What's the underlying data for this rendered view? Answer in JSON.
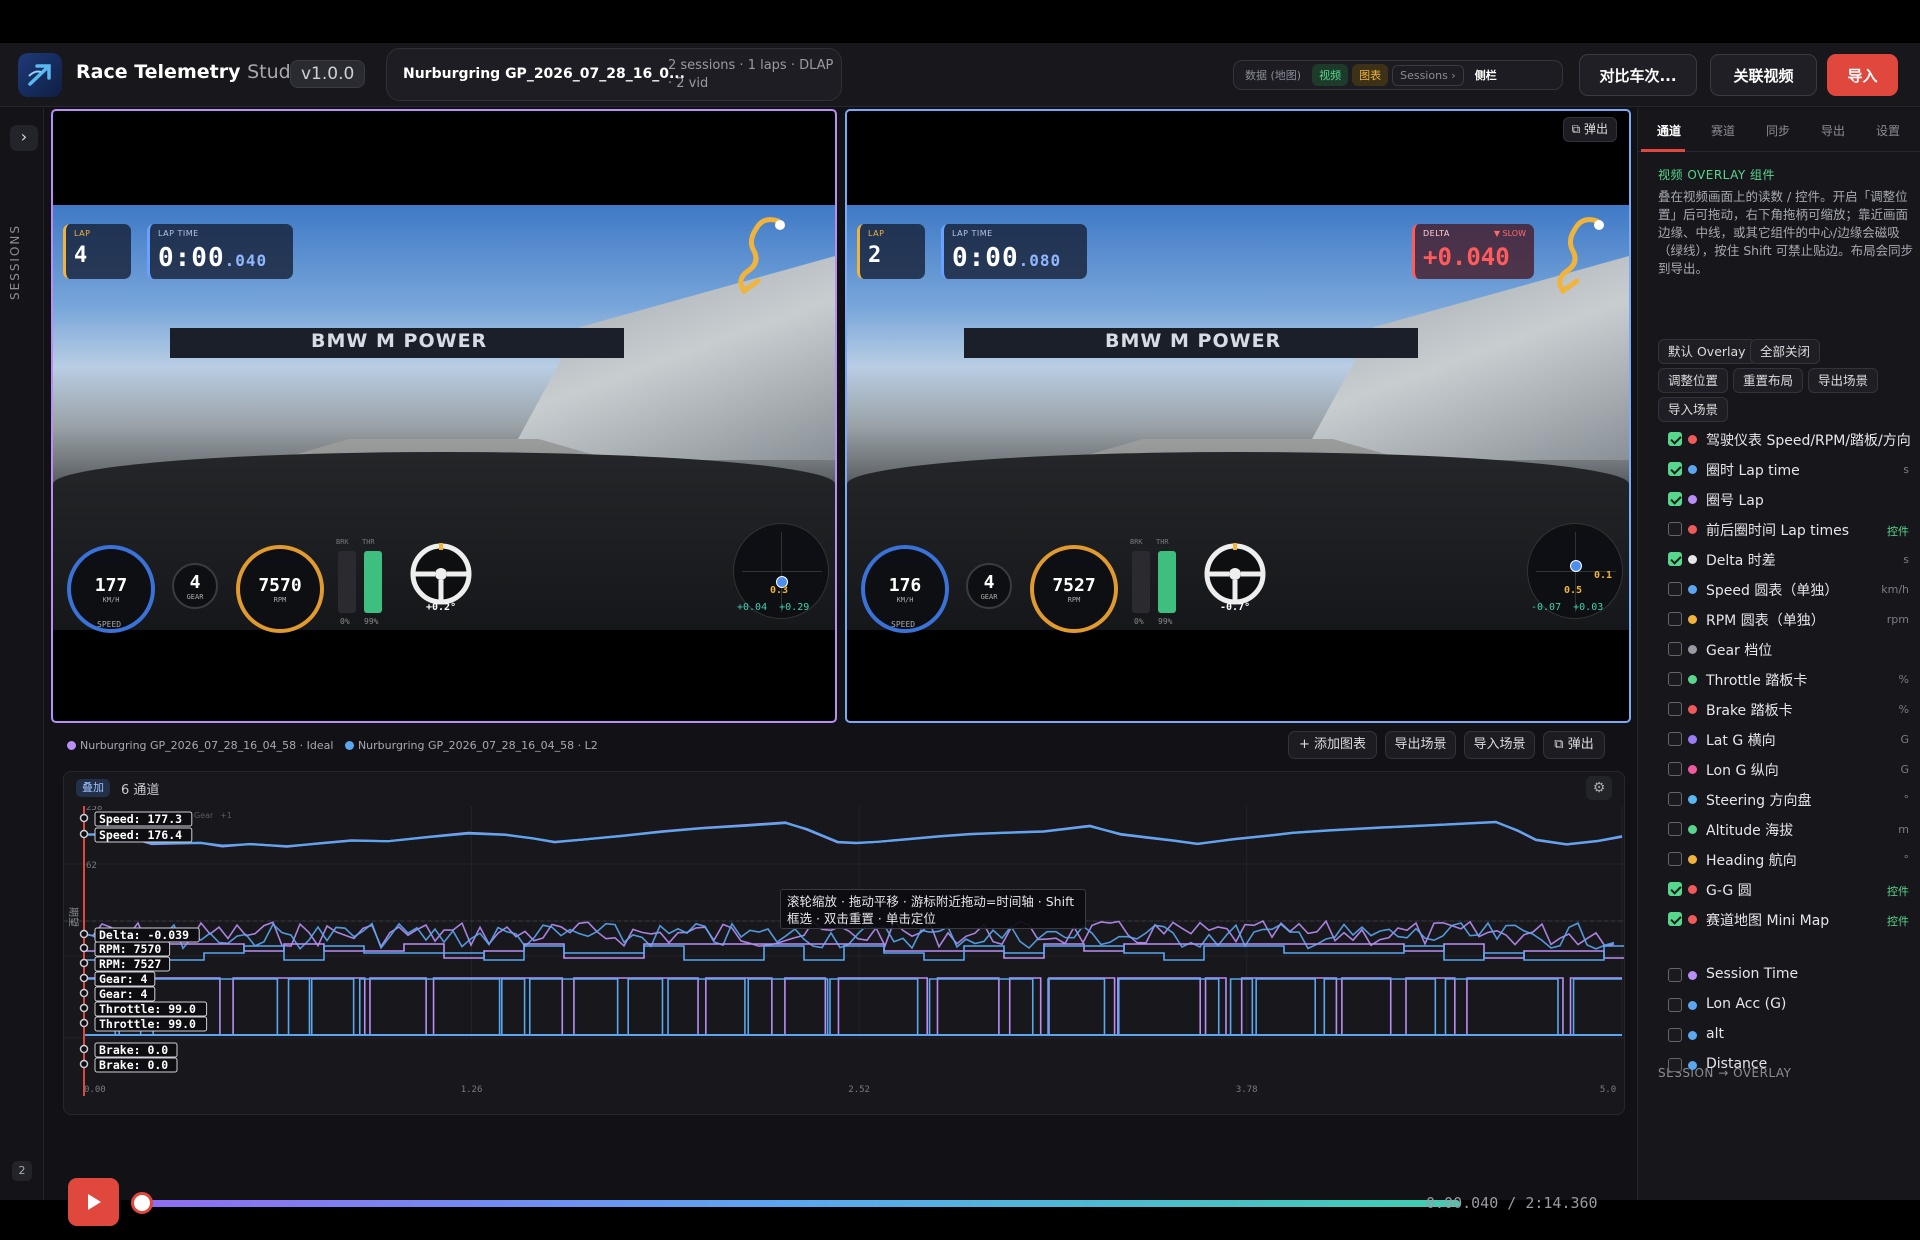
{
  "app": {
    "name": "Race Telemetry",
    "suffix": "Studio",
    "version": "v1.0.0"
  },
  "session": {
    "name": "Nurburgring GP_2026_07_28_16_0...",
    "meta": "2 sessions · 1 laps · DLAP · 2 vid"
  },
  "view_toggle": [
    {
      "label": "数据 (地图)",
      "style": "plain"
    },
    {
      "label": "视频",
      "style": "green"
    },
    {
      "label": "图表",
      "style": "amber"
    },
    {
      "label": "Sessions ›",
      "style": "outline"
    },
    {
      "label": "侧栏",
      "style": "bold"
    }
  ],
  "header_buttons": {
    "compare": "对比车次...",
    "link_video": "关联视频",
    "import": "导入"
  },
  "rail": {
    "label": "SESSIONS",
    "toggle": "›",
    "count": "2"
  },
  "video_a": {
    "lap_label": "LAP",
    "lap": "4",
    "laptime_label": "LAP TIME",
    "laptime_main": "0:00",
    "laptime_ms": ".040",
    "speed": "177",
    "speed_unit": "KM/H",
    "speed_label": "SPEED",
    "gear": "4",
    "gear_label": "GEAR",
    "rpm": "7570",
    "rpm_label": "RPM",
    "brk": "BRK",
    "thr": "THR",
    "brk_val": "0%",
    "thr_val": "99%",
    "steer": "+0.2°",
    "gg_center": "0.3",
    "gg_bottom": "+0.04  +0.29",
    "gantry": "BMW  M POWER",
    "border_color": "#b98ef5"
  },
  "video_b": {
    "lap_label": "LAP",
    "lap": "2",
    "laptime_label": "LAP TIME",
    "laptime_main": "0:00",
    "laptime_ms": ".080",
    "delta_label": "DELTA",
    "delta_state": "▼ SLOW",
    "delta": "+0.040",
    "speed": "176",
    "speed_unit": "KM/H",
    "speed_label": "SPEED",
    "gear": "4",
    "gear_label": "GEAR",
    "rpm": "7527",
    "rpm_label": "RPM",
    "brk": "BRK",
    "thr": "THR",
    "brk_val": "0%",
    "thr_val": "99%",
    "steer": "-0.7°",
    "gg_right": "0.1",
    "gg_center": "0.5",
    "gg_bottom": "-0.07  +0.03",
    "popout": "弹出",
    "gantry": "BMW  M POWER",
    "border_color": "#7aa9f5"
  },
  "charts_section": {
    "legend": [
      {
        "label": "Nurburgring GP_2026_07_28_16_04_58 · Ideal",
        "color": "#b98ef5"
      },
      {
        "label": "Nurburgring GP_2026_07_28_16_04_58 · L2",
        "color": "#5aa7f0"
      }
    ],
    "buttons": {
      "add_chart": "+ 添加图表",
      "export_scene": "导出场景",
      "import_scene": "导入场景",
      "popout": "弹出"
    },
    "overlay_badge": "叠加",
    "channel_count": "6 通道",
    "tooltip": "滚轮缩放 · 拖动平移 · 游标附近拖动=时间轴 · Shift 框选 · 双击重置 · 单击定位",
    "cursor_tags": [
      "Speed: 177.3",
      "Speed: 176.4",
      "Delta: -0.039",
      "RPM: 7570",
      "RPM: 7527",
      "Gear: 4",
      "Gear: 4",
      "Throttle: 99.0",
      "Throttle: 99.0",
      "Brake: 0.0",
      "Brake: 0.0"
    ],
    "speed_axis": [
      "258",
      "62"
    ],
    "faint_labels": [
      "RPM",
      "Gear",
      "+1"
    ],
    "side_label": "期望",
    "x_ticks": [
      "0.00",
      "1.26",
      "2.52",
      "3.78",
      "5.0"
    ]
  },
  "chart_data": {
    "type": "line",
    "x_label": "",
    "xlim": [
      0,
      5.0
    ],
    "x_ticks": [
      0.0,
      1.26,
      2.52,
      3.78,
      5.0
    ],
    "speed_range": [
      62,
      258
    ],
    "cursor_x": 0.0,
    "series": [
      {
        "name": "Nurburgring GP_2026_07_28_16_04_58 · Ideal",
        "color": "#b98ef5"
      },
      {
        "name": "Nurburgring GP_2026_07_28_16_04_58 · L2",
        "color": "#5aa7f0"
      }
    ],
    "speed": {
      "x": [
        0,
        0.11,
        0.15,
        0.22,
        0.38,
        0.45,
        0.54,
        0.66,
        0.77,
        0.87,
        0.99,
        1.12,
        1.25,
        1.37,
        1.46,
        1.53,
        1.62,
        1.75,
        1.88,
        2.01,
        2.15,
        2.28,
        2.35,
        2.45,
        2.51,
        2.58,
        2.68,
        2.78,
        2.88,
        2.99,
        3.12,
        3.27,
        3.37,
        3.54,
        3.62,
        3.74,
        3.87,
        3.93,
        4.05,
        4.22,
        4.41,
        4.59,
        4.66,
        4.72,
        4.82,
        4.92,
        5.0
      ],
      "ideal": [
        177,
        176,
        165,
        142,
        146,
        133,
        142,
        132,
        145,
        155,
        152,
        168,
        182,
        176,
        162,
        148,
        158,
        172,
        188,
        200,
        210,
        220,
        194,
        148,
        145,
        150,
        160,
        170,
        178,
        183,
        188,
        208,
        176,
        154,
        142,
        160,
        175,
        183,
        192,
        202,
        212,
        222,
        190,
        156,
        140,
        152,
        168
      ],
      "l2": [
        176,
        176,
        166,
        144,
        146,
        136,
        141,
        134,
        144,
        154,
        152,
        167,
        180,
        175,
        162,
        150,
        158,
        171,
        186,
        199,
        208,
        218,
        196,
        150,
        146,
        150,
        159,
        169,
        177,
        182,
        187,
        206,
        178,
        155,
        143,
        159,
        174,
        182,
        191,
        201,
        211,
        221,
        192,
        158,
        141,
        153,
        170
      ]
    },
    "cursor_values": {
      "ideal": {
        "speed": 177.3,
        "rpm": 7570,
        "gear": 4,
        "throttle": 99.0,
        "brake": 0.0
      },
      "l2": {
        "speed": 176.4,
        "rpm": 7527,
        "gear": 4,
        "throttle": 99.0,
        "brake": 0.0
      },
      "delta": -0.039
    }
  },
  "player": {
    "current": "0:00.040",
    "total": "2:14.360",
    "progress": 0.0003
  },
  "panel": {
    "tabs": [
      "通道",
      "赛道",
      "同步",
      "导出",
      "设置"
    ],
    "section_title": "视频 OVERLAY 组件",
    "description": "叠在视频画面上的读数 / 控件。开启「调整位置」后可拖动，右下角拖柄可缩放；靠近画面边缘、中线，或其它组件的中心/边缘会磁吸（绿线），按住 Shift 可禁止贴边。布局会同步到导出。",
    "buttons": [
      "默认 Overlay",
      "全部关闭",
      "调整位置",
      "重置布局",
      "导出场景",
      "导入场景"
    ],
    "items": [
      {
        "label": "驾驶仪表 Speed/RPM/踏板/方向",
        "checked": true,
        "dot": "#ef5a5a",
        "unit": ""
      },
      {
        "label": "圈时 Lap time",
        "checked": true,
        "dot": "#5aa7f0",
        "unit": "s"
      },
      {
        "label": "圈号 Lap",
        "checked": true,
        "dot": "#b98ef5",
        "unit": ""
      },
      {
        "label": "前后圈时间 Lap times",
        "checked": false,
        "dot": "#ef5a5a",
        "unit": "控件"
      },
      {
        "label": "Delta 时差",
        "checked": true,
        "dot": "#e6e6ea",
        "unit": "s"
      },
      {
        "label": "Speed 圆表（单独）",
        "checked": false,
        "dot": "#5aa7f0",
        "unit": "km/h"
      },
      {
        "label": "RPM 圆表（单独）",
        "checked": false,
        "dot": "#f0b43c",
        "unit": "rpm"
      },
      {
        "label": "Gear 档位",
        "checked": false,
        "dot": "#9a9aa4",
        "unit": ""
      },
      {
        "label": "Throttle 踏板卡",
        "checked": false,
        "dot": "#58d68d",
        "unit": "%"
      },
      {
        "label": "Brake 踏板卡",
        "checked": false,
        "dot": "#ef5a5a",
        "unit": "%"
      },
      {
        "label": "Lat G 横向",
        "checked": false,
        "dot": "#9a7cf5",
        "unit": "G"
      },
      {
        "label": "Lon G 纵向",
        "checked": false,
        "dot": "#ef5aa0",
        "unit": "G"
      },
      {
        "label": "Steering 方向盘",
        "checked": false,
        "dot": "#5ab8f0",
        "unit": "°"
      },
      {
        "label": "Altitude 海拔",
        "checked": false,
        "dot": "#58d68d",
        "unit": "m"
      },
      {
        "label": "Heading 航向",
        "checked": false,
        "dot": "#f0b43c",
        "unit": "°"
      },
      {
        "label": "G-G 圆",
        "checked": true,
        "dot": "#ef5a5a",
        "unit": "控件"
      },
      {
        "label": "赛道地图 Mini Map",
        "checked": true,
        "dot": "#ef5a5a",
        "unit": "控件"
      }
    ],
    "sub_title": "SESSION → OVERLAY",
    "session_items": [
      {
        "label": "Session Time",
        "checked": false,
        "dot": "#b98ef5"
      },
      {
        "label": "Lon Acc (G)",
        "checked": false,
        "dot": "#5aa7f0"
      },
      {
        "label": "alt",
        "checked": false,
        "dot": "#5aa7f0"
      },
      {
        "label": "Distance",
        "checked": false,
        "dot": "#5aa7f0"
      }
    ]
  }
}
